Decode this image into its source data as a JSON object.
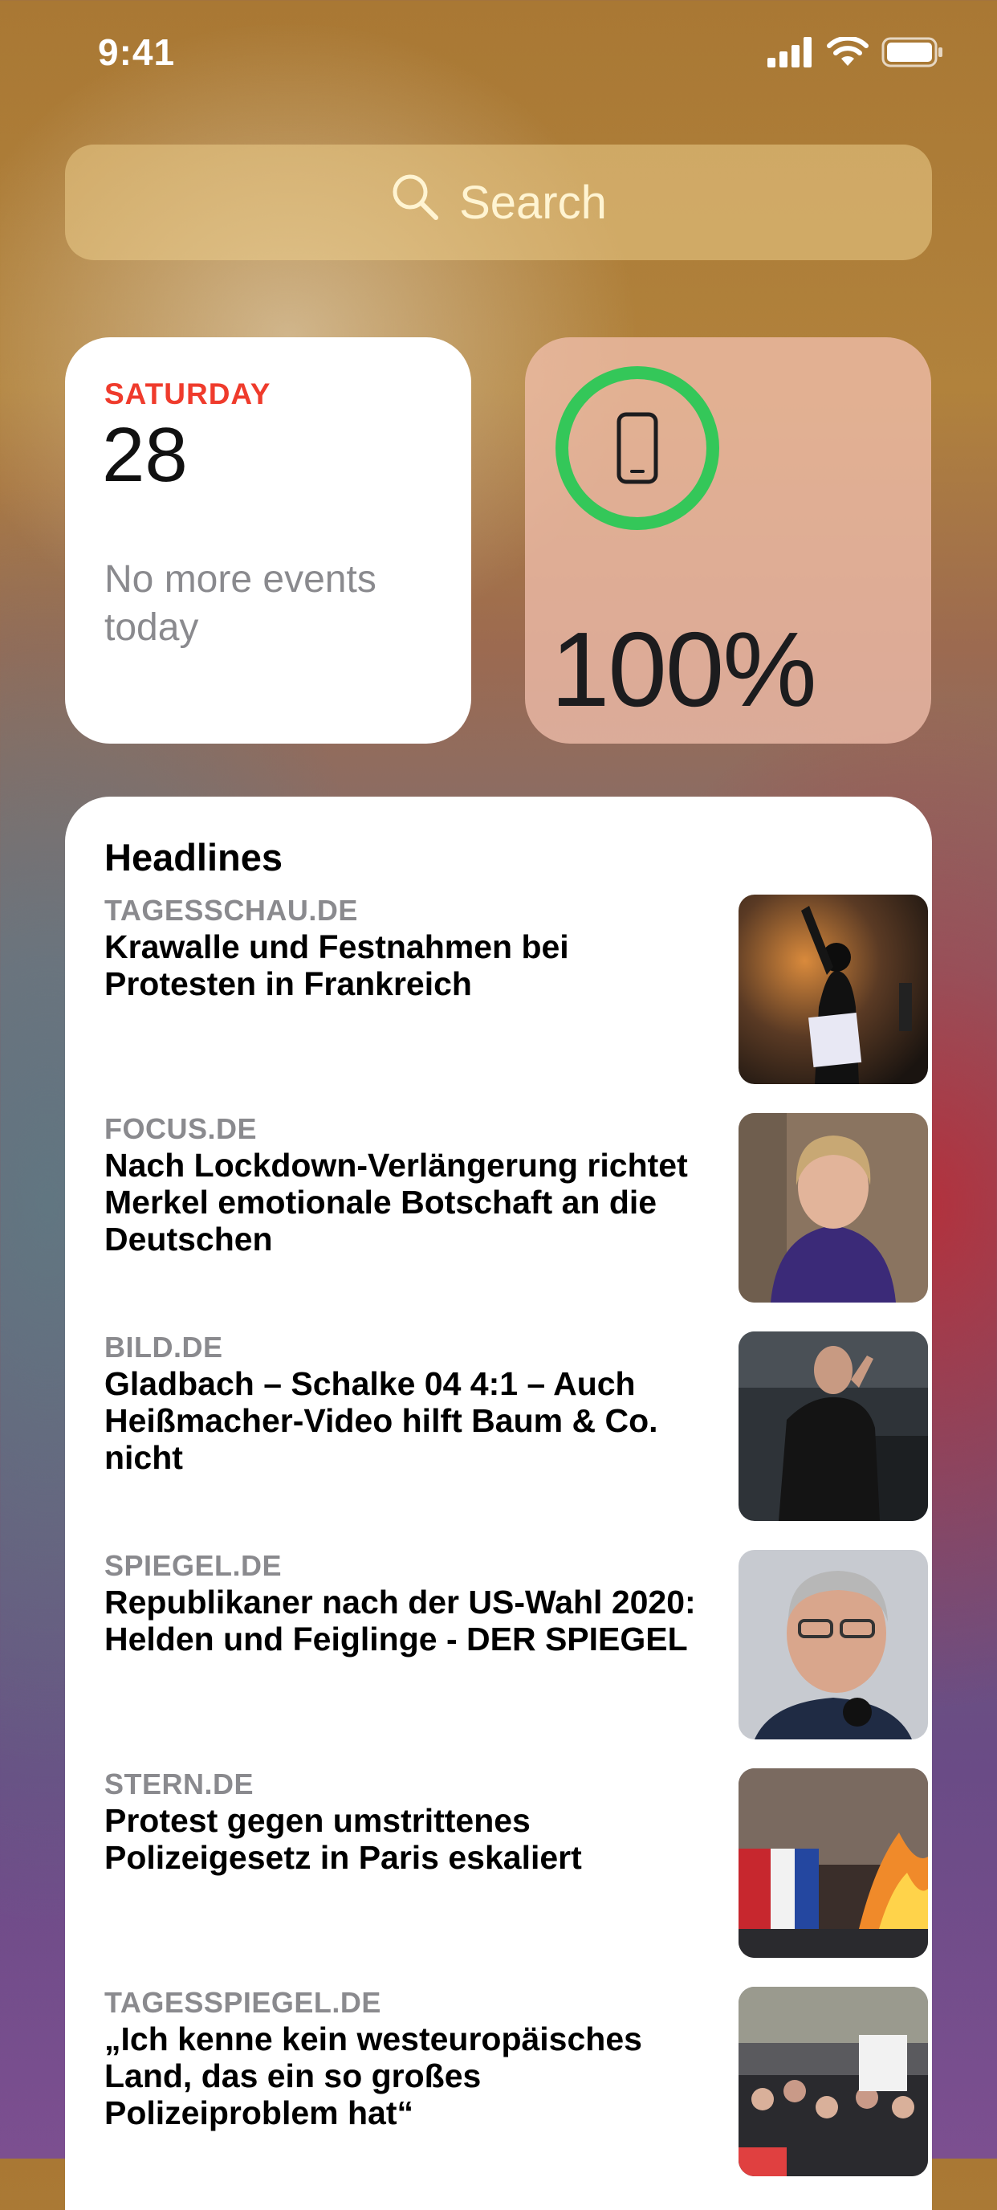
{
  "status_bar": {
    "time": "9:41",
    "icons": [
      "signal-icon",
      "wifi-icon",
      "battery-icon"
    ]
  },
  "search": {
    "placeholder": "Search",
    "icon": "search-icon"
  },
  "calendar_widget": {
    "day": "SATURDAY",
    "date": "28",
    "events_text": "No more events today"
  },
  "battery_widget": {
    "icon": "iphone-icon",
    "percent": "100%",
    "level": 1.0,
    "ring_color": "#34c759"
  },
  "news_widget": {
    "title": "Headlines",
    "articles": [
      {
        "source": "TAGESSCHAU.DE",
        "headline": "Krawalle und Festnahmen bei Protesten in Frankreich"
      },
      {
        "source": "FOCUS.DE",
        "headline": "Nach Lockdown-Verlängerung richtet Merkel emotionale Botschaft an die Deutschen"
      },
      {
        "source": "BILD.DE",
        "headline": "Gladbach – Schalke 04 4:1 – Auch Heißmacher-Video hilft Baum & Co. nicht"
      },
      {
        "source": "SPIEGEL.DE",
        "headline": "Republikaner nach der US-Wahl 2020: Helden und Feiglinge - DER SPIEGEL"
      },
      {
        "source": "STERN.DE",
        "headline": "Protest gegen umstrittenes Polizeigesetz in Paris eskaliert"
      },
      {
        "source": "TAGESSPIEGEL.DE",
        "headline": "„Ich kenne kein westeuropäisches Land, das ein so großes Polizeiproblem hat“"
      }
    ]
  },
  "colors": {
    "accent_red": "#ef3b2c",
    "secondary_text": "#8a8a8e",
    "battery_green": "#34c759"
  }
}
